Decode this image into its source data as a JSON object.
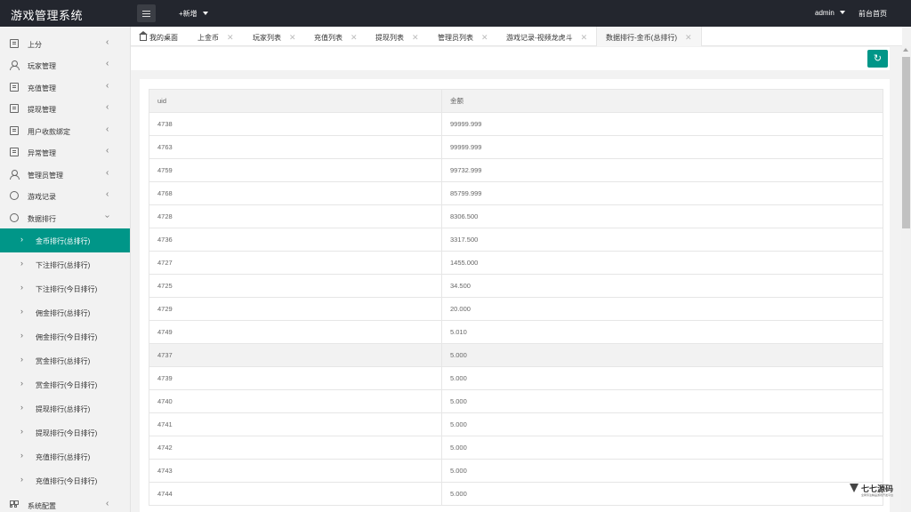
{
  "header": {
    "title": "游戏管理系统",
    "add_new": "+新增",
    "user": "admin",
    "frontpage": "前台首页"
  },
  "sidebar": {
    "items": [
      {
        "label": "上分",
        "icon": "document-icon"
      },
      {
        "label": "玩家管理",
        "icon": "user-icon"
      },
      {
        "label": "充值管理",
        "icon": "document-icon"
      },
      {
        "label": "提现管理",
        "icon": "document-icon"
      },
      {
        "label": "用户收款绑定",
        "icon": "document-icon"
      },
      {
        "label": "异常管理",
        "icon": "document-icon"
      },
      {
        "label": "管理员管理",
        "icon": "admin-user-icon"
      },
      {
        "label": "游戏记录",
        "icon": "circle-icon"
      },
      {
        "label": "数据排行",
        "icon": "circle-icon"
      }
    ],
    "sub_items": [
      "金币排行(总排行)",
      "下注排行(总排行)",
      "下注排行(今日排行)",
      "佣金排行(总排行)",
      "佣金排行(今日排行)",
      "赏金排行(总排行)",
      "赏金排行(今日排行)",
      "提现排行(总排行)",
      "提现排行(今日排行)",
      "充值排行(总排行)",
      "充值排行(今日排行)"
    ],
    "bottom_item": "系统配置"
  },
  "tabs": [
    "我的桌面",
    "上金币",
    "玩家列表",
    "充值列表",
    "提现列表",
    "管理员列表",
    "游戏记录-视频龙虎斗",
    "数据排行-金币(总排行)"
  ],
  "table": {
    "headers": [
      "uid",
      "金额"
    ],
    "rows": [
      [
        "4738",
        "99999.999"
      ],
      [
        "4763",
        "99999.999"
      ],
      [
        "4759",
        "99732.999"
      ],
      [
        "4768",
        "85799.999"
      ],
      [
        "4728",
        "8306.500"
      ],
      [
        "4736",
        "3317.500"
      ],
      [
        "4727",
        "1455.000"
      ],
      [
        "4725",
        "34.500"
      ],
      [
        "4729",
        "20.000"
      ],
      [
        "4749",
        "5.010"
      ],
      [
        "4737",
        "5.000"
      ],
      [
        "4739",
        "5.000"
      ],
      [
        "4740",
        "5.000"
      ],
      [
        "4741",
        "5.000"
      ],
      [
        "4742",
        "5.000"
      ],
      [
        "4743",
        "5.000"
      ],
      [
        "4744",
        "5.000"
      ]
    ]
  },
  "watermark": {
    "name": "七七源码",
    "tagline": "全网专注精品游戏开发平台"
  },
  "colors": {
    "accent": "#009688",
    "header_bg": "#23262e"
  }
}
